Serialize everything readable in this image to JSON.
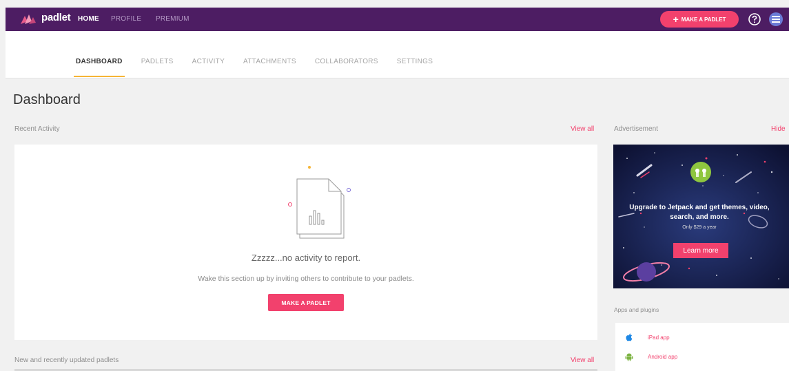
{
  "topbar": {
    "brand": "padlet",
    "nav": {
      "home": "HOME",
      "profile": "PROFILE",
      "premium": "PREMIUM"
    },
    "make_button": "MAKE A PADLET"
  },
  "tabs": [
    {
      "label": "DASHBOARD",
      "active": true
    },
    {
      "label": "PADLETS",
      "active": false
    },
    {
      "label": "ACTIVITY",
      "active": false
    },
    {
      "label": "ATTACHMENTS",
      "active": false
    },
    {
      "label": "COLLABORATORS",
      "active": false
    },
    {
      "label": "SETTINGS",
      "active": false
    }
  ],
  "main": {
    "title": "Dashboard",
    "recent_activity": {
      "label": "Recent Activity",
      "view_all": "View all",
      "empty_title": "Zzzzz...no activity to report.",
      "empty_subtitle": "Wake this section up by inviting others to contribute to your padlets.",
      "button": "MAKE A PADLET"
    },
    "recent_padlets": {
      "label": "New and recently updated padlets",
      "view_all": "View all"
    }
  },
  "sidebar": {
    "ad_label": "Advertisement",
    "hide": "Hide",
    "ad": {
      "headline_line1": "Upgrade to Jetpack and get themes, video,",
      "headline_line2": "search, and more.",
      "price": "Only $29 a year",
      "button": "Learn more"
    },
    "apps_label": "Apps and plugins",
    "apps": [
      {
        "label": "iPad app",
        "icon": "apple-icon"
      },
      {
        "label": "Android app",
        "icon": "android-icon"
      }
    ]
  },
  "colors": {
    "topbar": "#4d1d63",
    "accent_pink": "#f2416d",
    "tab_underline": "#f6b536"
  }
}
